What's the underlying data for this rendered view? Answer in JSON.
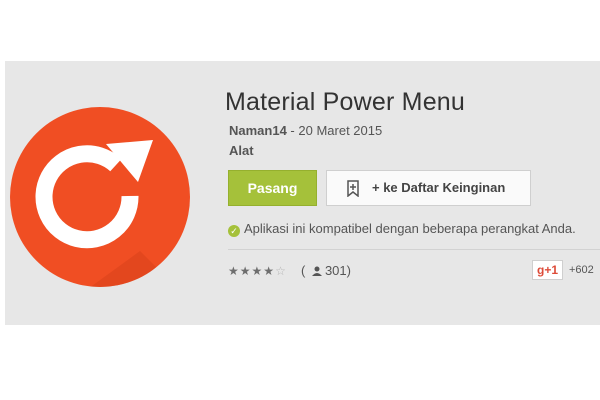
{
  "app": {
    "title": "Material Power Menu",
    "developer": "Naman14",
    "date_separator": " - ",
    "date": "20 Maret 2015",
    "category": "Alat",
    "icon": "refresh-icon"
  },
  "actions": {
    "install_label": "Pasang",
    "wishlist_label": "+ ke Daftar Keinginan"
  },
  "compat_text": "Aplikasi ini kompatibel dengan beberapa perangkat Anda.",
  "rating": {
    "stars": 4,
    "max_stars": 5,
    "open": "( ",
    "count": "301",
    "close": ")"
  },
  "gplus": {
    "label": "g+1",
    "count": "+602"
  },
  "colors": {
    "icon_orange": "#f04e23",
    "install_green": "#a5c13a",
    "card_bg": "#e7e7e7"
  }
}
